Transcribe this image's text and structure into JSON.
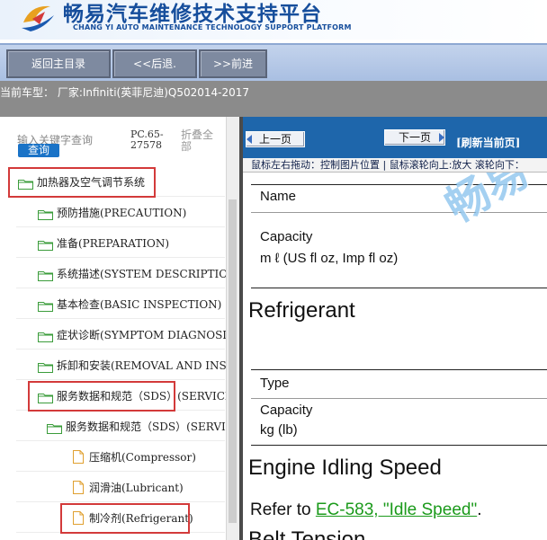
{
  "header": {
    "title": "畅易汽车维修技术支持平台",
    "subtitle": "CHANG YI AUTO MAINTENANCE TECHNOLOGY SUPPORT PLATFORM"
  },
  "toolbar": {
    "home_label": "返回主目录",
    "back_label": "<<后退.",
    "forward_label": ">>前进"
  },
  "current_vehicle": "当前车型：  厂家:Infiniti(英菲尼迪)Q502014-2017",
  "left_panel": {
    "search_placeholder": "输入关键字查询",
    "query_label": "查询",
    "pc_code": "PC.65-27578",
    "collapse_all": "折叠全部",
    "tree": [
      {
        "label": "加热器及空气调节系统",
        "type": "folder",
        "highlighted": true
      },
      {
        "label": "预防措施(PRECAUTION)",
        "type": "folder"
      },
      {
        "label": "准备(PREPARATION)",
        "type": "folder"
      },
      {
        "label": "系统描述(SYSTEM DESCRIPTION)",
        "type": "folder"
      },
      {
        "label": "基本检查(BASIC INSPECTION)",
        "type": "folder"
      },
      {
        "label": "症状诊断(SYMPTOM DIAGNOSIS)",
        "type": "folder"
      },
      {
        "label": "拆卸和安装(REMOVAL AND INSTALLATION)",
        "type": "folder"
      },
      {
        "label": "服务数据和规范（SDS）(SERVICE DATA AND SPECIFICATIONS)",
        "type": "folder",
        "highlighted": true
      },
      {
        "label": "服务数据和规范（SDS）(SERVICE DATA AND SPECIFICATIONS)",
        "type": "folder"
      },
      {
        "label": "压缩机(Compressor)",
        "type": "doc"
      },
      {
        "label": "润滑油(Lubricant)",
        "type": "doc"
      },
      {
        "label": "制冷剂(Refrigerant)",
        "type": "doc",
        "highlighted": true
      }
    ]
  },
  "viewer": {
    "prev_label": "上一页",
    "next_label": "下一页",
    "refresh_label": "[刷新当前页]",
    "hint": "鼠标左右拖动：控制图片位置 | 鼠标滚轮向上:放大  滚轮向下：",
    "watermark": "畅易",
    "doc": {
      "table1_col1": "Name",
      "table1_capacity_label": "Capacity",
      "table1_capacity_unit": "m ℓ (US fl oz, Imp fl oz)",
      "section_refrigerant": "Refrigerant",
      "table2_type": "Type",
      "table2_capacity_label": "Capacity",
      "table2_capacity_unit": "kg (lb)",
      "section_idle": "Engine Idling Speed",
      "refer_prefix": "Refer to ",
      "refer_link": "EC-583, \"Idle Speed\"",
      "refer_suffix": ".",
      "section_belt": "Belt Tension"
    }
  },
  "colors": {
    "brand": "#164e9c",
    "highlight": "#d33a3a",
    "viewer_bar": "#1e66ab",
    "link": "#1b9a1b"
  }
}
